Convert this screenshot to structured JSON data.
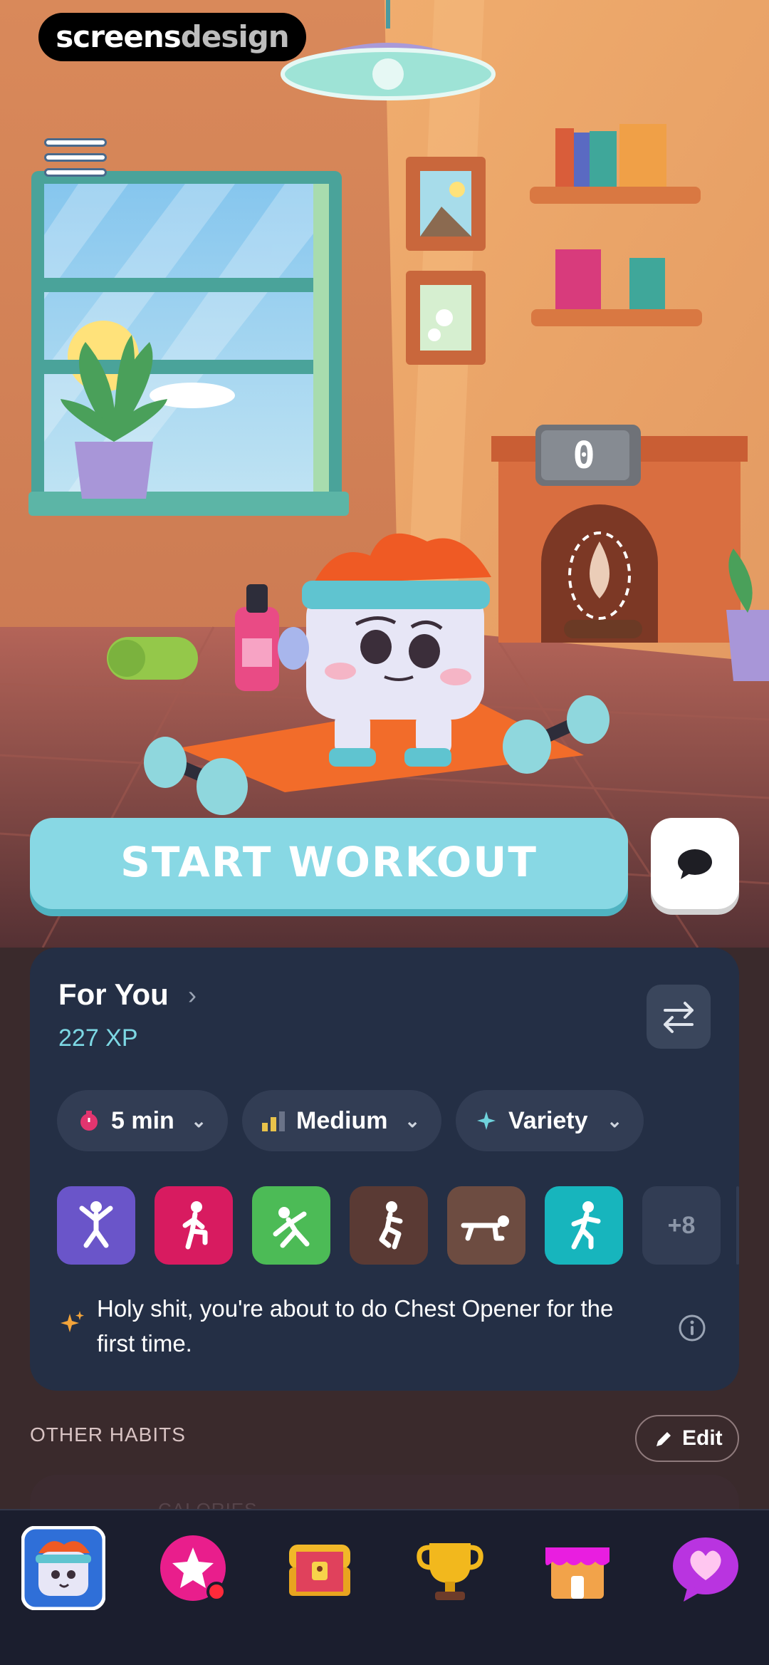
{
  "badge": {
    "brand_bold": "screens",
    "brand_light": "design"
  },
  "scene": {
    "fire_clock_value": "0"
  },
  "actions": {
    "start_workout": "START WORKOUT"
  },
  "card": {
    "title": "For You",
    "chevron": "›",
    "xp": "227 XP",
    "filters": [
      {
        "label": "5 min",
        "icon": "stopwatch-icon"
      },
      {
        "label": "Medium",
        "icon": "difficulty-bars-icon"
      },
      {
        "label": "Variety",
        "icon": "sparkle-icon"
      }
    ],
    "exercises": [
      {
        "icon": "jumping-jack-icon",
        "color": "#6a55c9"
      },
      {
        "icon": "high-knees-icon",
        "color": "#d81b60"
      },
      {
        "icon": "stretch-icon",
        "color": "#4cbb56"
      },
      {
        "icon": "squat-icon",
        "color": "#5a3a34"
      },
      {
        "icon": "plank-icon",
        "color": "#6d4c41"
      },
      {
        "icon": "boxing-icon",
        "color": "#17b5bd"
      }
    ],
    "more_count": "+8",
    "tip": "Holy shit, you're about to do Chest Opener for the first time."
  },
  "habits": {
    "section_label": "OTHER HABITS",
    "edit_label": "Edit",
    "next_card_label": "CALORIES"
  },
  "tabbar": {
    "items": [
      {
        "name": "profile-avatar-tab",
        "selected": true
      },
      {
        "name": "star-tab",
        "badge": true
      },
      {
        "name": "treasure-chest-tab"
      },
      {
        "name": "trophy-tab"
      },
      {
        "name": "shop-tab"
      },
      {
        "name": "heart-chat-tab"
      }
    ]
  },
  "colors": {
    "accent": "#88d8e4",
    "card_bg": "#242f45",
    "xp": "#7dd8e4"
  }
}
